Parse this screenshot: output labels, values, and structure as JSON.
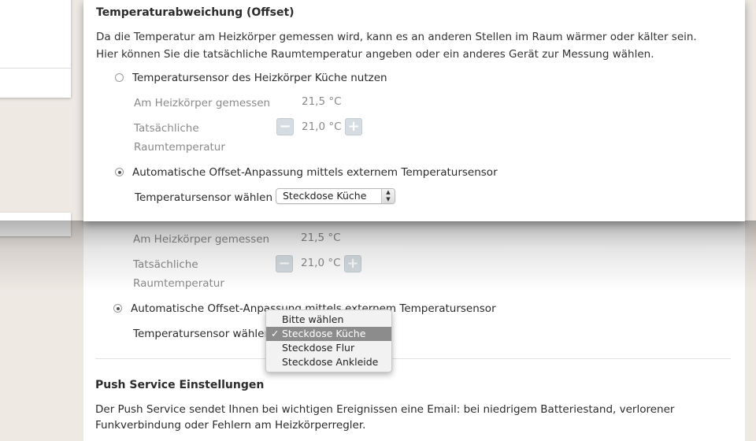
{
  "offset": {
    "title": "Temperaturabweichung (Offset)",
    "description": "Da die Temperatur am Heizkörper gemessen wird, kann es an anderen Stellen im Raum wärmer oder kälter sein. Hier können Sie die tatsächliche Raumtemperatur angeben oder ein anderes Gerät zur Messung wählen.",
    "option_manual": "Temperatursensor des Heizkörper Küche nutzen",
    "measured_label": "Am Heizkörper gemessen",
    "measured_value": "21,5 °C",
    "actual_label_line1": "Tatsächliche",
    "actual_label_line2": "Raumtemperatur",
    "actual_value": "21,0 °C",
    "minus": "−",
    "plus": "+",
    "option_auto": "Automatische Offset-Anpassung mittels externem Temperatursensor",
    "sensor_label": "Temperatursensor wählen",
    "sensor_selected": "Steckdose Küche"
  },
  "dropdown": {
    "options": [
      "Bitte wählen",
      "Steckdose Küche",
      "Steckdose Flur",
      "Steckdose Ankleide"
    ],
    "check": "✓",
    "arrows_up": "▲",
    "arrows_down": "▼"
  },
  "push": {
    "title": "Push Service Einstellungen",
    "line1": "Der Push Service sendet Ihnen bei wichtigen Ereignissen eine Email: bei niedrigem Batteriestand, verlorener",
    "line2": "Funkverbindung oder Fehlern am Heizkörperregler."
  }
}
